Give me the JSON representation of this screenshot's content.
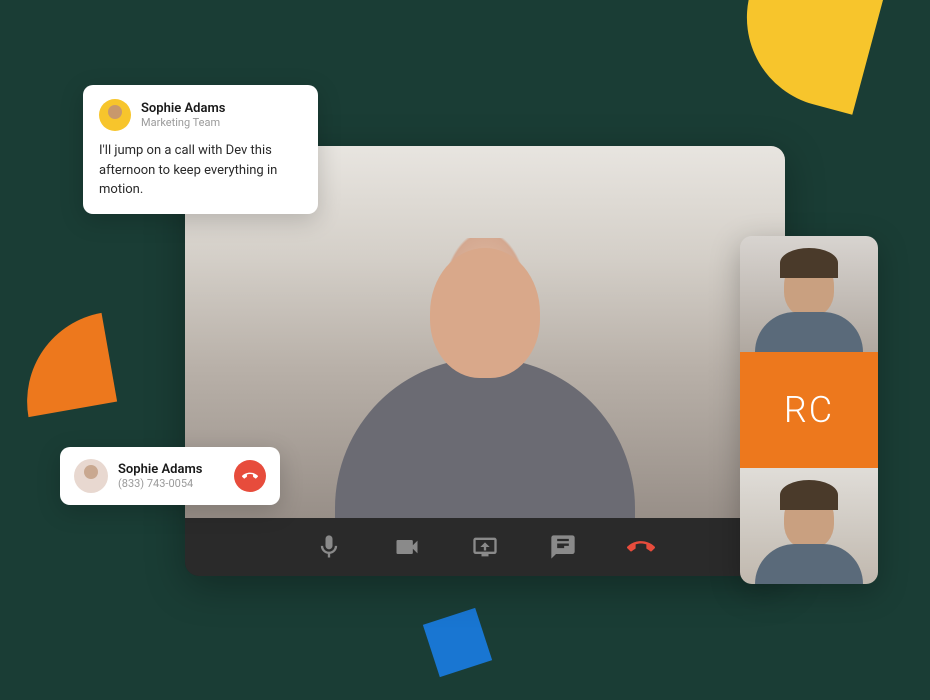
{
  "chat": {
    "name": "Sophie Adams",
    "subtitle": "Marketing Team",
    "message": "I'll jump on a call with Dev this afternoon to keep everything in motion."
  },
  "call": {
    "name": "Sophie Adams",
    "phone": "(833) 743-0054"
  },
  "participants": {
    "initials_tile": "RC"
  },
  "controls": {
    "mic": "microphone",
    "video": "video-camera",
    "share": "screen-share",
    "chat": "chat",
    "hangup": "end-call"
  }
}
